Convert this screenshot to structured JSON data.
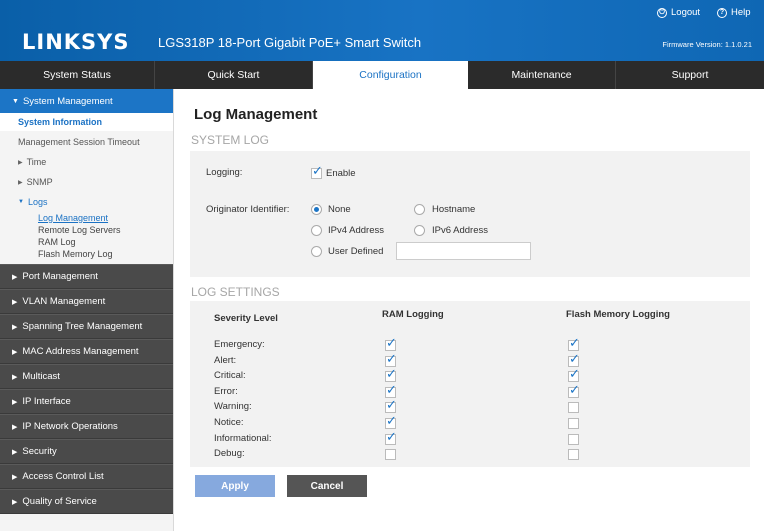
{
  "header": {
    "brand": "LINKSYS",
    "product": "LGS318P 18-Port Gigabit PoE+ Smart Switch",
    "logout": "Logout",
    "help": "Help",
    "firmware": "Firmware Version: 1.1.0.21"
  },
  "nav": {
    "tabs": [
      {
        "label": "System Status"
      },
      {
        "label": "Quick Start"
      },
      {
        "label": "Configuration"
      },
      {
        "label": "Maintenance"
      },
      {
        "label": "Support"
      }
    ]
  },
  "sidebar": {
    "system_management": "System Management",
    "system_information": "System Information",
    "mgmt_session_timeout": "Management Session Timeout",
    "time": "Time",
    "snmp": "SNMP",
    "logs": "Logs",
    "log_items": [
      "Log Management",
      "Remote Log Servers",
      "RAM Log",
      "Flash Memory Log"
    ],
    "sections": [
      "Port Management",
      "VLAN Management",
      "Spanning Tree Management",
      "MAC Address Management",
      "Multicast",
      "IP Interface",
      "IP Network Operations",
      "Security",
      "Access Control List",
      "Quality of Service"
    ]
  },
  "main": {
    "title": "Log Management",
    "system_log": {
      "heading": "SYSTEM LOG",
      "logging_label": "Logging:",
      "enable_label": "Enable",
      "originator_label": "Originator Identifier:",
      "options": {
        "none": "None",
        "hostname": "Hostname",
        "ipv4": "IPv4 Address",
        "ipv6": "IPv6 Address",
        "user_defined": "User Defined"
      },
      "selected": "None",
      "user_defined_value": ""
    },
    "log_settings": {
      "heading": "LOG SETTINGS",
      "col_severity": "Severity Level",
      "col_ram": "RAM Logging",
      "col_flash": "Flash Memory Logging",
      "levels": [
        {
          "name": "Emergency:",
          "ram": true,
          "flash": true
        },
        {
          "name": "Alert:",
          "ram": true,
          "flash": true
        },
        {
          "name": "Critical:",
          "ram": true,
          "flash": true
        },
        {
          "name": "Error:",
          "ram": true,
          "flash": true
        },
        {
          "name": "Warning:",
          "ram": true,
          "flash": false
        },
        {
          "name": "Notice:",
          "ram": true,
          "flash": false
        },
        {
          "name": "Informational:",
          "ram": true,
          "flash": false
        },
        {
          "name": "Debug:",
          "ram": false,
          "flash": false
        }
      ]
    },
    "buttons": {
      "apply": "Apply",
      "cancel": "Cancel"
    }
  },
  "colors": {
    "accent": "#1c75c6",
    "nav_bg": "#2b2b2b",
    "sidebar_dark": "#4a4a4a",
    "apply_bg": "#86a9de",
    "cancel_bg": "#555555"
  }
}
